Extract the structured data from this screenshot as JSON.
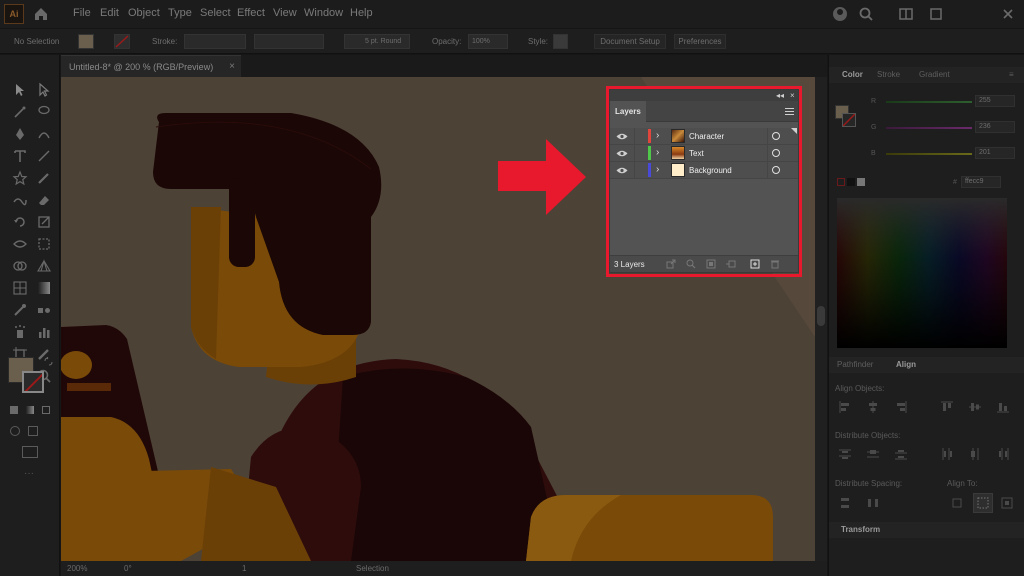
{
  "menubar": {
    "logo": "Ai",
    "items": [
      "File",
      "Edit",
      "Object",
      "Type",
      "Select",
      "Effect",
      "View",
      "Window",
      "Help"
    ]
  },
  "controlbar": {
    "selection": "No Selection",
    "stroke_label": "Stroke:",
    "brush": "5 pt. Round",
    "opacity_label": "Opacity:",
    "opacity_value": "100%",
    "style_label": "Style:",
    "document_setup": "Document Setup",
    "preferences": "Preferences"
  },
  "document": {
    "tab_title": "Untitled-8* @ 200 % (RGB/Preview)",
    "close": "×"
  },
  "statusbar": {
    "zoom": "200%",
    "rotation": "0°",
    "artboard": "1",
    "tool": "Selection"
  },
  "layers_panel": {
    "tab": "Layers",
    "count": "3 Layers",
    "collapse": "◂◂",
    "close": "×",
    "layers": [
      {
        "name": "Character",
        "color": "#e0463c"
      },
      {
        "name": "Text",
        "color": "#4fc84a"
      },
      {
        "name": "Background",
        "color": "#4a4ad8"
      }
    ]
  },
  "color_panel": {
    "tabs": [
      "Color",
      "Stroke",
      "Gradient"
    ],
    "channels": [
      {
        "label": "R",
        "value": "255"
      },
      {
        "label": "G",
        "value": "236"
      },
      {
        "label": "B",
        "value": "201"
      }
    ],
    "hex_label": "#",
    "hex": "ffecc9"
  },
  "align_panel": {
    "tabs": [
      "Pathfinder",
      "Align"
    ],
    "align_objects": "Align Objects:",
    "distribute_objects": "Distribute Objects:",
    "distribute_spacing": "Distribute Spacing:",
    "align_to": "Align To:"
  },
  "transform_panel": {
    "tab": "Transform"
  },
  "colors": {
    "highlight": "#e8192c",
    "canvas_bg": "#4d4236",
    "hair": "#1a0706",
    "skin": "#7a4a08"
  }
}
